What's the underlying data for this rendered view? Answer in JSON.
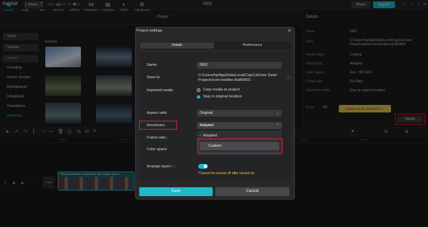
{
  "app": {
    "logo": "CapCut",
    "menu_label": "Menu",
    "autosave": "Auto saved: 07:21:07",
    "project_title": "0601",
    "share_label": "Share",
    "export_label": "Export",
    "accent": "#1fb8c9"
  },
  "toolbar": {
    "items": [
      {
        "label": "Media",
        "icon": "media-icon"
      },
      {
        "label": "Audio",
        "icon": "audio-icon"
      },
      {
        "label": "Text",
        "icon": "text-icon"
      },
      {
        "label": "Stickers",
        "icon": "stickers-icon"
      },
      {
        "label": "Effects",
        "icon": "effects-icon"
      },
      {
        "label": "Transitions",
        "icon": "transitions-icon"
      },
      {
        "label": "Captions",
        "icon": "captions-icon"
      },
      {
        "label": "Filters",
        "icon": "filters-icon"
      },
      {
        "label": "Adjustment",
        "icon": "adjustment-icon"
      }
    ]
  },
  "left_nav": {
    "items": [
      "Yours",
      "Spaces",
      "Library",
      "Trending",
      "Green Screen",
      "Background",
      "Intro&End",
      "Transitions",
      "Warming"
    ]
  },
  "media": {
    "section_label": "Scenery"
  },
  "player": {
    "label": "Player"
  },
  "details": {
    "title": "Details",
    "rows": [
      {
        "label": "Name",
        "value": "0601"
      },
      {
        "label": "Path",
        "value": "C:/Users/hp/AppData/Local/CapCut/User Data/Projects/com.lveditor.draft/0601"
      },
      {
        "label": "Aspect ratio",
        "value": "Original"
      },
      {
        "label": "Resolution",
        "value": "Adapted"
      },
      {
        "label": "Color space",
        "value": "Rec. 709 SDR"
      },
      {
        "label": "Frame rate",
        "value": "30.00fps"
      },
      {
        "label": "Imported media",
        "value": "Stay in original location"
      },
      {
        "label": "Proxy",
        "value": "Off"
      }
    ],
    "layers_tip": "Layers can be reordered in...",
    "modify_label": "Modify"
  },
  "timeline": {
    "ticks": [
      "00:00",
      "00:03",
      "00:06",
      "00:09",
      "00:12",
      "00:15"
    ],
    "cover_label": "Cover",
    "clip_label": "Primary transition, simple title with leather text at"
  },
  "dialog": {
    "title": "Project settings",
    "tabs": [
      "Details",
      "Performance"
    ],
    "fields": {
      "name_label": "Name",
      "name_value": "0601",
      "save_to_label": "Save to",
      "save_to_value": "C:/Users/hp/AppData/Local/CapCut/User Data/ Projects/com.lveditor.draft/0601",
      "imported_media_label": "Imported media",
      "copy_option": "Copy media to project",
      "stay_option": "Stay in original location",
      "aspect_ratio_label": "Aspect ratio",
      "aspect_ratio_value": "Original",
      "resolution_label": "Resolution",
      "resolution_value": "Adapted",
      "frame_rate_label": "Frame rate",
      "color_space_label": "Color space",
      "arrange_layers_label": "Arrange layers",
      "arrange_layers_warning": "*Cannot be turned off after turned on."
    },
    "dropdown_options": [
      "Adapted",
      "Custom"
    ],
    "save_label": "Save",
    "cancel_label": "Cancel",
    "highlight_color": "#d9242f"
  }
}
